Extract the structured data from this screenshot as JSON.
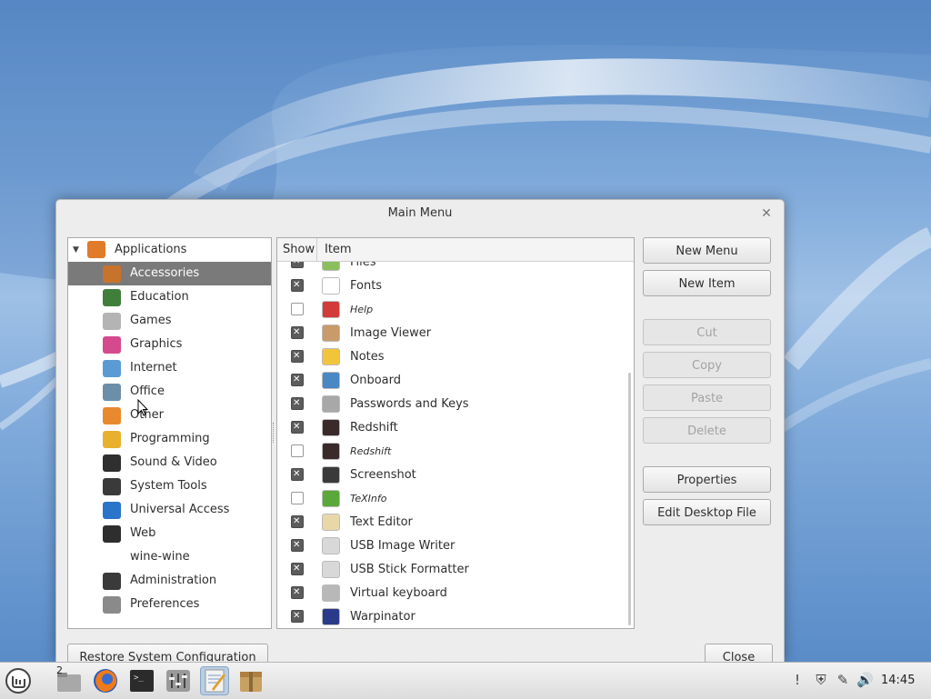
{
  "dialog": {
    "title": "Main Menu",
    "close_glyph": "✕",
    "tree": {
      "root": {
        "label": "Applications",
        "icon": "applications-icon",
        "color": "#e07b2a"
      },
      "categories": [
        {
          "label": "Accessories",
          "icon": "accessories-icon",
          "color": "#c8732c",
          "selected": true
        },
        {
          "label": "Education",
          "icon": "education-icon",
          "color": "#3f7f3a"
        },
        {
          "label": "Games",
          "icon": "games-icon",
          "color": "#b4b4b4"
        },
        {
          "label": "Graphics",
          "icon": "graphics-icon",
          "color": "#d44a8c"
        },
        {
          "label": "Internet",
          "icon": "internet-icon",
          "color": "#5b9bd5"
        },
        {
          "label": "Office",
          "icon": "office-icon",
          "color": "#6b8fa8"
        },
        {
          "label": "Other",
          "icon": "other-icon",
          "color": "#e8892d"
        },
        {
          "label": "Programming",
          "icon": "programming-icon",
          "color": "#e8b02d"
        },
        {
          "label": "Sound & Video",
          "icon": "sound-video-icon",
          "color": "#2f2f2f"
        },
        {
          "label": "System Tools",
          "icon": "system-tools-icon",
          "color": "#3a3a3a"
        },
        {
          "label": "Universal Access",
          "icon": "universal-access-icon",
          "color": "#2a74c9"
        },
        {
          "label": "Web",
          "icon": "web-icon",
          "color": "#2e2e2e"
        },
        {
          "label": "wine-wine",
          "icon": "",
          "color": ""
        },
        {
          "label": "Administration",
          "icon": "administration-icon",
          "color": "#3a3a3a"
        },
        {
          "label": "Preferences",
          "icon": "preferences-icon",
          "color": "#8a8a8a"
        }
      ]
    },
    "list": {
      "col_show": "Show",
      "col_item": "Item",
      "items": [
        {
          "label": "Files",
          "shown": true,
          "icon": "files-icon",
          "color": "#8bbf5c"
        },
        {
          "label": "Fonts",
          "shown": true,
          "icon": "fonts-icon",
          "color": "#ffffff"
        },
        {
          "label": "Help",
          "shown": false,
          "icon": "help-icon",
          "color": "#d33a3a"
        },
        {
          "label": "Image Viewer",
          "shown": true,
          "icon": "image-viewer-icon",
          "color": "#c99a6a"
        },
        {
          "label": "Notes",
          "shown": true,
          "icon": "notes-icon",
          "color": "#f2c43a"
        },
        {
          "label": "Onboard",
          "shown": true,
          "icon": "onboard-icon",
          "color": "#4a87c5"
        },
        {
          "label": "Passwords and Keys",
          "shown": true,
          "icon": "passwords-keys-icon",
          "color": "#a8a8a8"
        },
        {
          "label": "Redshift",
          "shown": true,
          "icon": "redshift-icon",
          "color": "#3a2a2a"
        },
        {
          "label": "Redshift",
          "shown": false,
          "icon": "redshift-icon",
          "color": "#3a2a2a"
        },
        {
          "label": "Screenshot",
          "shown": true,
          "icon": "screenshot-icon",
          "color": "#3a3a3a"
        },
        {
          "label": "TeXInfo",
          "shown": false,
          "icon": "texinfo-icon",
          "color": "#5aa83a"
        },
        {
          "label": "Text Editor",
          "shown": true,
          "icon": "text-editor-icon",
          "color": "#e8d8a8"
        },
        {
          "label": "USB Image Writer",
          "shown": true,
          "icon": "usb-image-writer-icon",
          "color": "#d8d8d8"
        },
        {
          "label": "USB Stick Formatter",
          "shown": true,
          "icon": "usb-stick-formatter-icon",
          "color": "#d8d8d8"
        },
        {
          "label": "Virtual keyboard",
          "shown": true,
          "icon": "virtual-keyboard-icon",
          "color": "#b8b8b8"
        },
        {
          "label": "Warpinator",
          "shown": true,
          "icon": "warpinator-icon",
          "color": "#2a3a8a"
        }
      ]
    },
    "buttons": {
      "new_menu": "New Menu",
      "new_item": "New Item",
      "cut": "Cut",
      "copy": "Copy",
      "paste": "Paste",
      "delete": "Delete",
      "properties": "Properties",
      "edit_desktop_file": "Edit Desktop File",
      "restore": "Restore System Configuration",
      "close": "Close"
    }
  },
  "taskbar": {
    "workspace_badge": "2",
    "clock": "14:45",
    "apps": [
      "files-icon",
      "firefox-icon",
      "terminal-icon",
      "mixer-icon",
      "text-editor-icon",
      "archive-icon"
    ],
    "tray": [
      "notification-icon",
      "shield-icon",
      "network-icon",
      "volume-icon"
    ]
  }
}
